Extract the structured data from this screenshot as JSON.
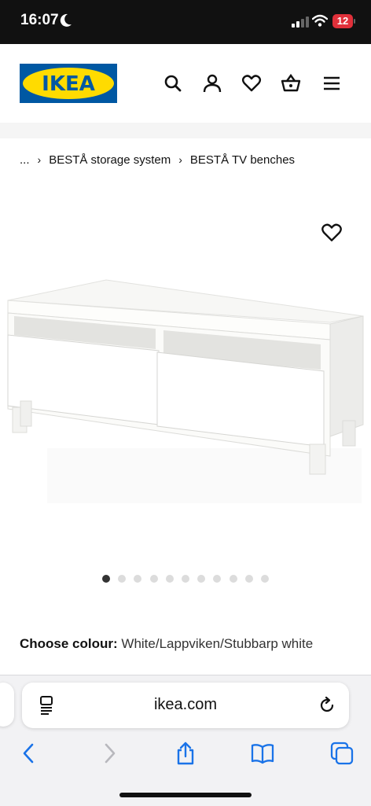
{
  "status_bar": {
    "time": "16:07",
    "battery": "12"
  },
  "header": {
    "logo_text": "IKEA",
    "colors": {
      "logo_blue": "#0058a3",
      "logo_yellow": "#ffdb00"
    },
    "icons": [
      "search-icon",
      "profile-icon",
      "heart-icon",
      "basket-icon",
      "menu-icon"
    ]
  },
  "breadcrumb": {
    "ellipsis": "...",
    "items": [
      {
        "label": "BESTÅ storage system"
      },
      {
        "label": "BESTÅ TV benches"
      }
    ]
  },
  "gallery": {
    "image_count": 11,
    "active_index": 0
  },
  "product": {
    "colour_label": "Choose colour:",
    "colour_value": "White/Lappviken/Stubbarp white"
  },
  "browser": {
    "url": "ikea.com",
    "toolbar_icons": [
      "back-icon",
      "forward-icon",
      "share-icon",
      "bookmarks-icon",
      "tabs-icon"
    ]
  }
}
